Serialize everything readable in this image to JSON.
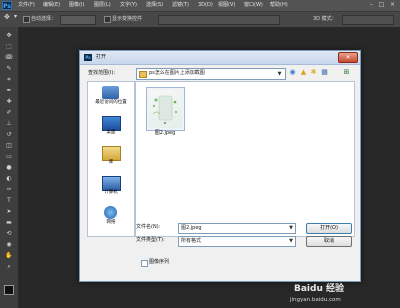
{
  "menubar": {
    "logo": "Ps",
    "items": [
      "文件(F)",
      "编辑(E)",
      "图像(I)",
      "图层(L)",
      "文字(Y)",
      "选择(S)",
      "滤镜(T)",
      "3D(D)",
      "视图(V)",
      "窗口(W)",
      "帮助(H)"
    ]
  },
  "optbar": {
    "auto_select": "自动选择：",
    "transform_controls": "显示变换控件",
    "mode_3d": "3D 模式："
  },
  "dialog": {
    "title": "打开",
    "close": "✕",
    "look_in_label": "查找范围(I):",
    "look_in_value": "ps怎么在图片上添加截图",
    "places": [
      {
        "label": "最近访问的位置",
        "icon": "recent-places-icon"
      },
      {
        "label": "桌面",
        "icon": "desktop-icon"
      },
      {
        "label": "库",
        "icon": "libraries-icon"
      },
      {
        "label": "计算机",
        "icon": "computer-icon"
      },
      {
        "label": "网络",
        "icon": "network-icon"
      }
    ],
    "file": {
      "name": "图2.jpeg"
    },
    "filename_label": "文件名(N):",
    "filename_value": "图2.jpeg",
    "filetype_label": "文件类型(T):",
    "filetype_value": "所有格式",
    "open_button": "打开(O)",
    "cancel_button": "取消",
    "image_sequence": "图像序列"
  },
  "watermark": {
    "logo": "Baidu 经验",
    "url": "jingyan.baidu.com"
  }
}
